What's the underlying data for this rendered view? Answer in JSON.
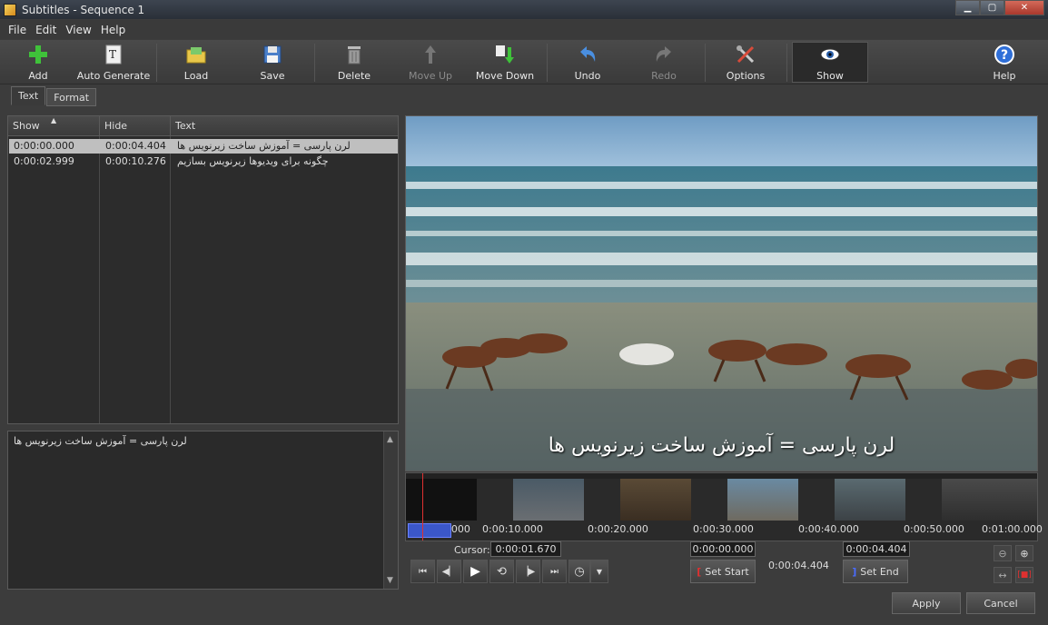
{
  "window": {
    "title": "Subtitles - Sequence 1"
  },
  "menu": [
    "File",
    "Edit",
    "View",
    "Help"
  ],
  "toolbar": {
    "add": "Add",
    "auto_generate": "Auto Generate",
    "load": "Load",
    "save": "Save",
    "delete": "Delete",
    "move_up": "Move Up",
    "move_down": "Move Down",
    "undo": "Undo",
    "redo": "Redo",
    "options": "Options",
    "show": "Show",
    "help": "Help"
  },
  "tabs": [
    "Text",
    "Format"
  ],
  "list": {
    "columns": [
      "Show",
      "Hide",
      "Text"
    ],
    "rows": [
      {
        "show": "0:00:00.000",
        "hide": "0:00:04.404",
        "text": "لرن پارسی = آموزش ساخت زیرنویس ها"
      },
      {
        "show": "0:00:02.999",
        "hide": "0:00:10.276",
        "text": "چگونه برای ویدیوها زیرنویس بسازیم"
      }
    ]
  },
  "editor": {
    "text": "لرن پارسی = آموزش ساخت زیرنویس ها"
  },
  "video": {
    "subtitle": "لرن پارسی = آموزش ساخت زیرنویس ها"
  },
  "timeline": {
    "labels": [
      "0:00:00.000",
      "0:00:10.000",
      "0:00:20.000",
      "0:00:30.000",
      "0:00:40.000",
      "0:00:50.000",
      "0:01:00.000"
    ]
  },
  "controls": {
    "cursor_label": "Cursor:",
    "cursor_value": "0:00:01.670",
    "start_value": "0:00:00.000",
    "end_value": "0:00:04.404",
    "duration": "0:00:04.404",
    "set_start": "Set Start",
    "set_end": "Set End"
  },
  "footer": {
    "apply": "Apply",
    "cancel": "Cancel"
  }
}
